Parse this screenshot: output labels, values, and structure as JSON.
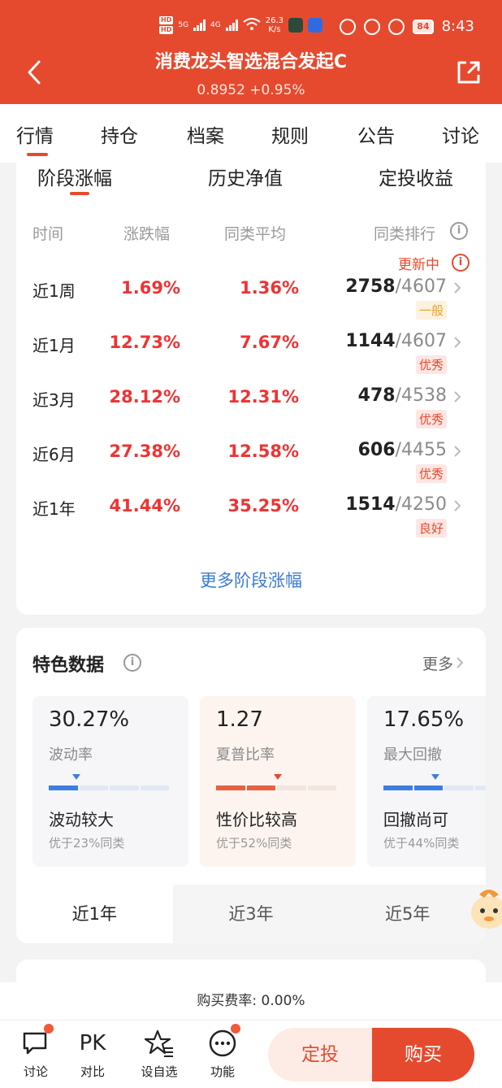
{
  "status_bar": {
    "net_speed": "26.3",
    "net_unit": "K/s",
    "battery": "84",
    "time": "8:43",
    "sim1": "HD",
    "sim2": "HD",
    "sig1": "5G",
    "sig2": "4G",
    "wifi": "6"
  },
  "header": {
    "title": "消费龙头智选混合发起C",
    "nav_value": "0.8952 +0.95%",
    "bg_color": "#e64a2e"
  },
  "main_tabs": [
    "行情",
    "持仓",
    "档案",
    "规则",
    "公告",
    "讨论"
  ],
  "sub_tabs": [
    "阶段涨幅",
    "历史净值",
    "定投收益"
  ],
  "returns_table": {
    "headers": [
      "时间",
      "涨跌幅",
      "同类平均",
      "同类排行"
    ],
    "updating": "更新中",
    "rows": [
      {
        "period": "近1周",
        "change": "1.69%",
        "avg": "1.36%",
        "rank": "2758",
        "total": "/4607",
        "badge": "一般"
      },
      {
        "period": "近1月",
        "change": "12.73%",
        "avg": "7.67%",
        "rank": "1144",
        "total": "/4607",
        "badge": "优秀"
      },
      {
        "period": "近3月",
        "change": "28.12%",
        "avg": "12.31%",
        "rank": "478",
        "total": "/4538",
        "badge": "优秀"
      },
      {
        "period": "近6月",
        "change": "27.38%",
        "avg": "12.58%",
        "rank": "606",
        "total": "/4455",
        "badge": "优秀"
      },
      {
        "period": "近1年",
        "change": "41.44%",
        "avg": "35.25%",
        "rank": "1514",
        "total": "/4250",
        "badge": "良好"
      }
    ],
    "more": "更多阶段涨幅"
  },
  "features": {
    "title": "特色数据",
    "more": "更多",
    "metrics": [
      {
        "value": "30.27%",
        "label": "波动率",
        "desc": "波动较大",
        "sub": "优于23%同类"
      },
      {
        "value": "1.27",
        "label": "夏普比率",
        "desc": "性价比较高",
        "sub": "优于52%同类"
      },
      {
        "value": "17.65%",
        "label": "最大回撤",
        "desc": "回撤尚可",
        "sub": "优于44%同类"
      }
    ],
    "periods": [
      "近1年",
      "近3年",
      "近5年"
    ]
  },
  "fee": "购买费率: 0.00%",
  "bottom_bar": {
    "items": [
      {
        "label": "讨论",
        "icon": "chat-icon"
      },
      {
        "label": "对比",
        "icon_text": "PK"
      },
      {
        "label": "设自选",
        "icon": "star-list-icon"
      },
      {
        "label": "功能",
        "icon": "more-dots-icon"
      }
    ],
    "sip": "定投",
    "buy": "购买"
  }
}
